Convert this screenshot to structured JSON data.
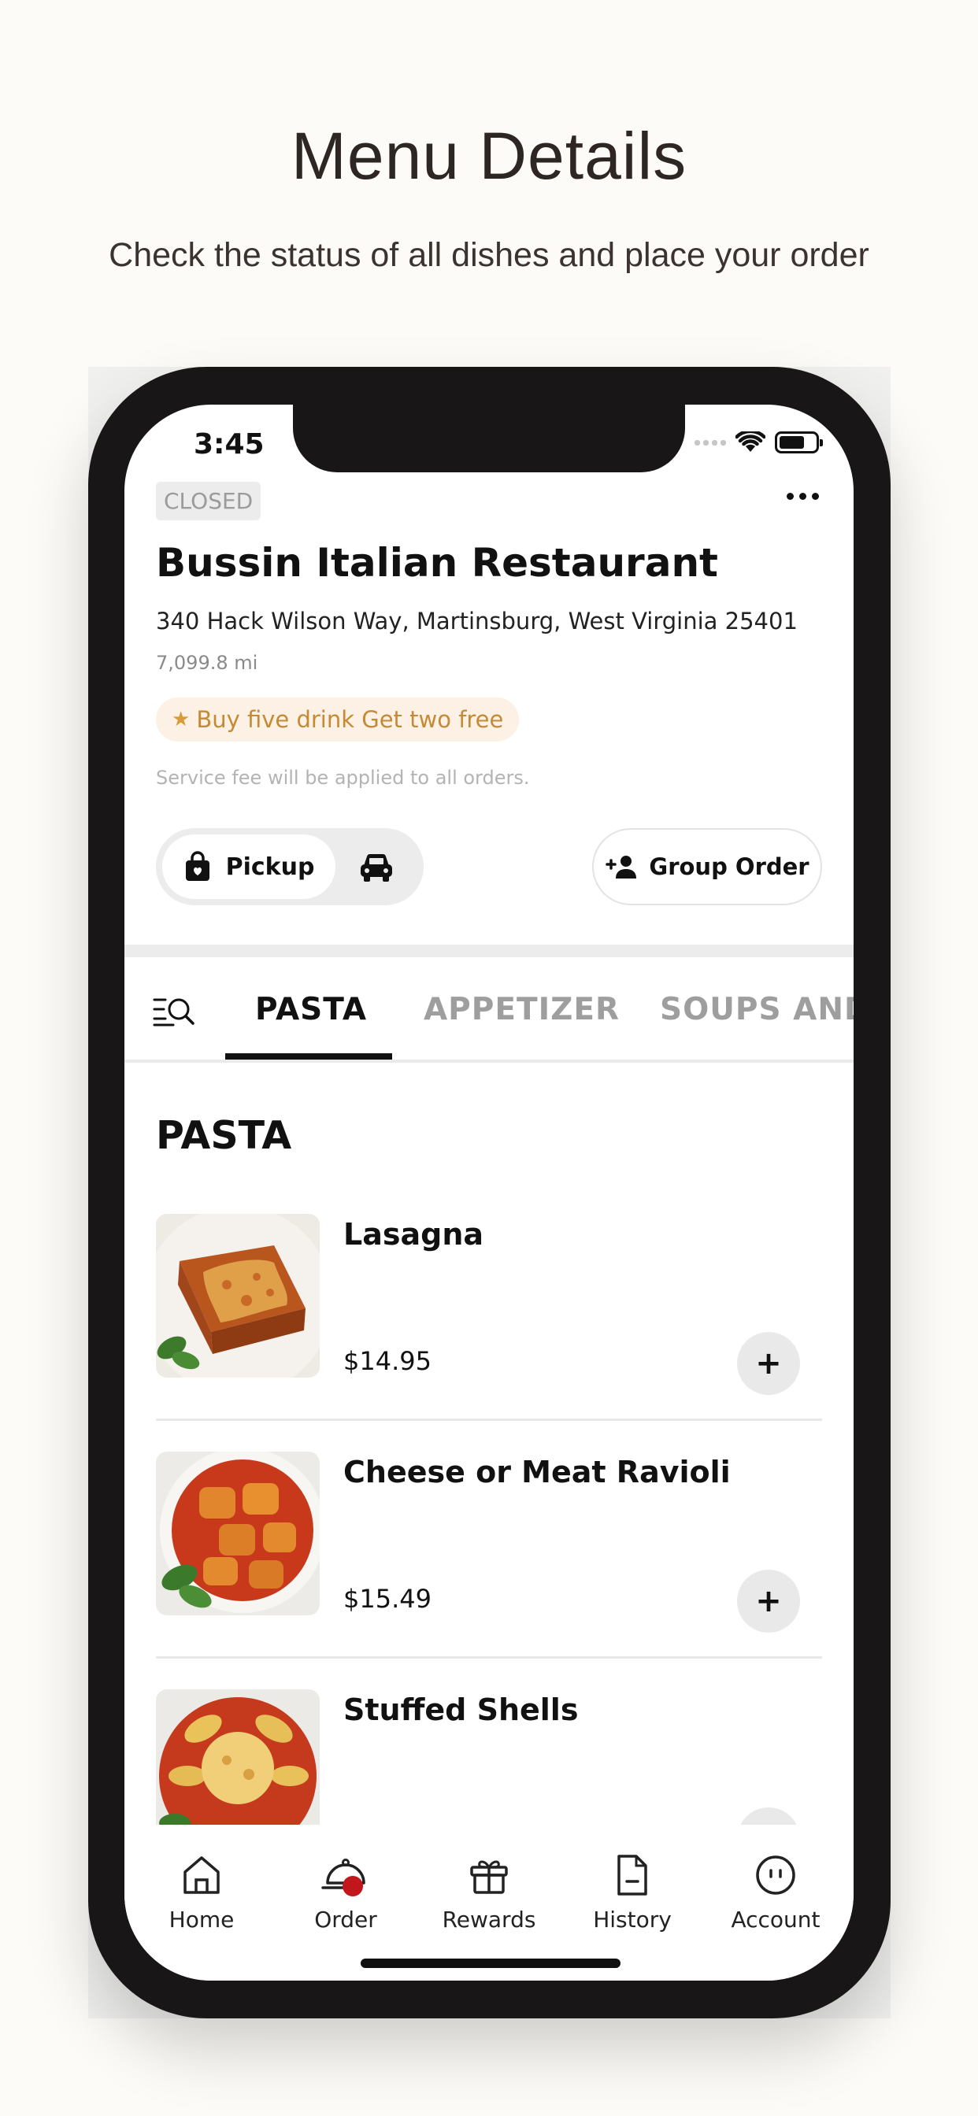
{
  "header": {
    "title": "Menu Details",
    "subtitle": "Check the status of all dishes and place your order"
  },
  "status_bar": {
    "time": "3:45",
    "battery_level": 0.7
  },
  "restaurant": {
    "status_badge": "CLOSED",
    "name": "Bussin Italian Restaurant",
    "address": "340 Hack Wilson Way, Martinsburg, West Virginia 25401",
    "distance": "7,099.8 mi",
    "promo": "Buy five drink Get two free",
    "service_fee_note": "Service fee will be applied to all orders."
  },
  "order_mode": {
    "selected": "Pickup",
    "pickup_label": "Pickup",
    "delivery_icon": "car-icon",
    "group_order_label": "Group Order"
  },
  "tabs": [
    {
      "label": "PASTA",
      "active": true
    },
    {
      "label": "APPETIZER",
      "active": false
    },
    {
      "label": "SOUPS AND",
      "active": false
    }
  ],
  "section": {
    "title": "PASTA",
    "items": [
      {
        "name": "Lasagna",
        "price": "$14.95"
      },
      {
        "name": "Cheese or Meat Ravioli",
        "price": "$15.49"
      },
      {
        "name": "Stuffed Shells",
        "price": ""
      }
    ]
  },
  "tabbar": [
    {
      "label": "Home",
      "icon": "home-icon"
    },
    {
      "label": "Order",
      "icon": "cloche-icon",
      "active": true
    },
    {
      "label": "Rewards",
      "icon": "gift-icon"
    },
    {
      "label": "History",
      "icon": "document-icon"
    },
    {
      "label": "Account",
      "icon": "account-icon"
    }
  ],
  "colors": {
    "accent": "#c0161c",
    "promo_text": "#c48a35",
    "promo_bg": "#fcf1e4",
    "page_bg": "#fdfbf7",
    "phone_frame": "#181616"
  }
}
